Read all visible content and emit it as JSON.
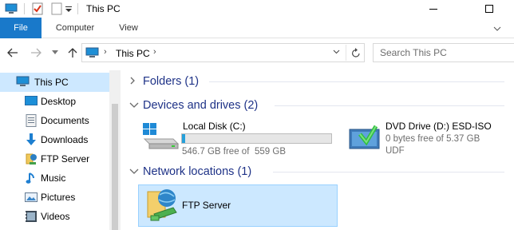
{
  "window": {
    "title": "This PC"
  },
  "ribbon": {
    "tabs": [
      {
        "label": "File"
      },
      {
        "label": "Computer"
      },
      {
        "label": "View"
      }
    ]
  },
  "address": {
    "path_label": "This PC"
  },
  "search": {
    "placeholder": "Search This PC"
  },
  "sidebar": {
    "items": [
      {
        "label": "This PC",
        "icon": "pc-icon",
        "selected": true
      },
      {
        "label": "Desktop",
        "icon": "desktop-icon"
      },
      {
        "label": "Documents",
        "icon": "documents-icon"
      },
      {
        "label": "Downloads",
        "icon": "downloads-icon"
      },
      {
        "label": "FTP Server",
        "icon": "network-location-icon"
      },
      {
        "label": "Music",
        "icon": "music-icon"
      },
      {
        "label": "Pictures",
        "icon": "pictures-icon"
      },
      {
        "label": "Videos",
        "icon": "videos-icon"
      }
    ]
  },
  "groups": {
    "folders": {
      "title": "Folders (1)",
      "expanded": false
    },
    "devices": {
      "title": "Devices and drives (2)",
      "expanded": true
    },
    "network": {
      "title": "Network locations (1)",
      "expanded": true
    }
  },
  "drives": [
    {
      "name": "Local Disk (C:)",
      "free": "546.7 GB free of",
      "total": "559 GB",
      "used_fraction": 0.022,
      "icon": "local-disk-icon"
    },
    {
      "name": "DVD Drive (D:) ESD-ISO",
      "free": "0 bytes free of 5.37 GB",
      "fs": "UDF",
      "icon": "dvd-drive-icon"
    }
  ],
  "network_locations": [
    {
      "name": "FTP Server",
      "icon": "ftp-server-icon"
    }
  ],
  "colors": {
    "accent": "#1979ca",
    "selection": "#cde8ff",
    "group_title": "#1e3287",
    "bar_fill": "#26a0da"
  }
}
